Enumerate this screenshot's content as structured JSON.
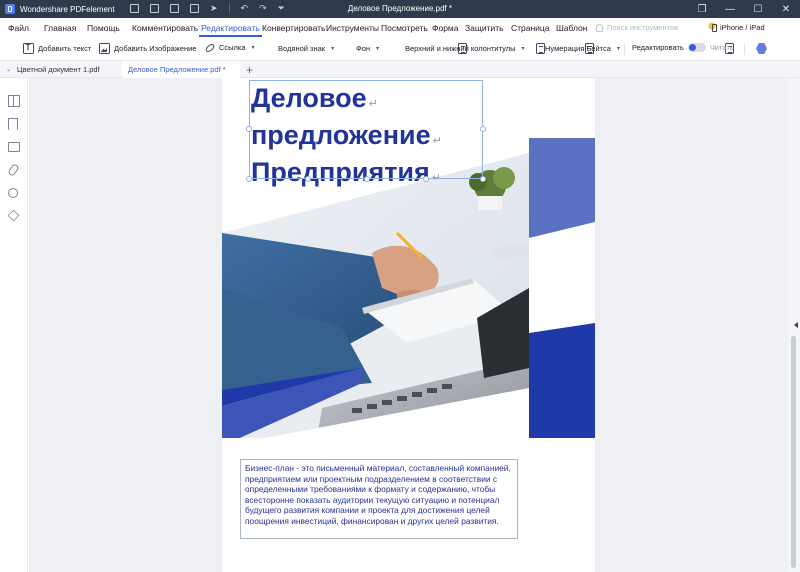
{
  "app": {
    "name": "Wondershare PDFelement",
    "document_title": "Деловое Предложение.pdf *"
  },
  "window_controls": {
    "minimize": "—",
    "maximize": "☐",
    "close": "✕"
  },
  "menu": {
    "items": [
      {
        "label": "Файл"
      },
      {
        "label": "Главная"
      },
      {
        "label": "Помощь"
      },
      {
        "label": "Комментировать"
      },
      {
        "label": "Редактировать",
        "active": true
      },
      {
        "label": "Конвертировать"
      },
      {
        "label": "Инструменты"
      },
      {
        "label": "Посмотреть"
      },
      {
        "label": "Форма"
      },
      {
        "label": "Защитить"
      },
      {
        "label": "Страница"
      },
      {
        "label": "Шаблон"
      }
    ],
    "search_placeholder": "Поиск инструментов",
    "device_link": "iPhone / iPad"
  },
  "toolbar": {
    "add_text": "Добавить текст",
    "add_image": "Добавить Изображение",
    "link": "Ссылка",
    "watermark": "Водяной знак",
    "background": "Фон",
    "header_footer": "Верхний и нижний колонтитулы",
    "bates": "Нумерация Бейтса",
    "edit_mode": "Редактировать",
    "read_mode": "Читать"
  },
  "tabs": [
    {
      "label": "Цветной документ 1.pdf"
    },
    {
      "label": "Деловое Предложение.pdf *",
      "active": true
    }
  ],
  "document": {
    "heading_lines": [
      "Деловое",
      "предложение",
      "Предприятия"
    ],
    "body_text": "Бизнес-план - это письменный материал, составленный компанией, предприятием или проектным подразделением в соответствии с определенными требованиями к формату и содержанию, чтобы всесторонне показать аудитории текущую ситуацию и потенциал будущего развития компании и проекта для достижения целей поощрения инвестиций, финансирован и других целей развития."
  },
  "colors": {
    "accent": "#3a5bd9",
    "heading": "#22339a",
    "brand_blue": "#1f3aa8",
    "titlebar": "#2f3a4c"
  }
}
